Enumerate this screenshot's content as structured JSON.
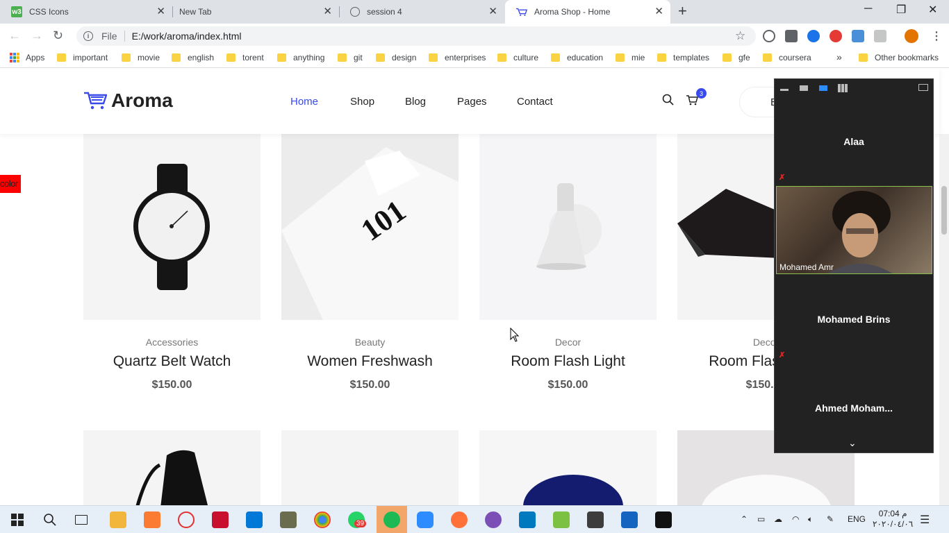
{
  "browser": {
    "tabs": [
      {
        "title": "CSS Icons",
        "icon": "w3schools-icon"
      },
      {
        "title": "New Tab",
        "icon": ""
      },
      {
        "title": "session 4",
        "icon": "globe-icon"
      },
      {
        "title": "Aroma Shop - Home",
        "icon": "cart-icon"
      }
    ],
    "address": {
      "scheme_label": "File",
      "url": "E:/work/aroma/index.html"
    },
    "bookmarks": {
      "apps_label": "Apps",
      "items": [
        "important",
        "movie",
        "english",
        "torent",
        "anything",
        "git",
        "design",
        "enterprises",
        "culture",
        "education",
        "mie",
        "templates",
        "gfe",
        "coursera"
      ],
      "more": "»",
      "other": "Other bookmarks"
    }
  },
  "site": {
    "logo": "Aroma",
    "menu": [
      "Home",
      "Shop",
      "Blog",
      "Pages",
      "Contact"
    ],
    "cart_count": "3",
    "header_button": "B",
    "color_tab": "color",
    "accent": "#384aeb",
    "products": [
      {
        "category": "Accessories",
        "name": "Quartz Belt Watch",
        "price": "$150.00"
      },
      {
        "category": "Beauty",
        "name": "Women Freshwash",
        "price": "$150.00"
      },
      {
        "category": "Decor",
        "name": "Room Flash Light",
        "price": "$150.00"
      },
      {
        "category": "Decor",
        "name": "Room Flash Light",
        "price": "$150.00"
      }
    ]
  },
  "zoom": {
    "participants": [
      {
        "name": "Alaa",
        "muted": false
      },
      {
        "name": "Mohamed Amr",
        "muted": true,
        "video": true
      },
      {
        "name": "Mohamed Brins",
        "muted": false
      },
      {
        "name": "Ahmed  Moham...",
        "muted": true
      }
    ]
  },
  "taskbar": {
    "badge": "39",
    "lang": "ENG",
    "time": "07:04 م",
    "date": "٢٠٢٠/٠٤/٠٦"
  }
}
